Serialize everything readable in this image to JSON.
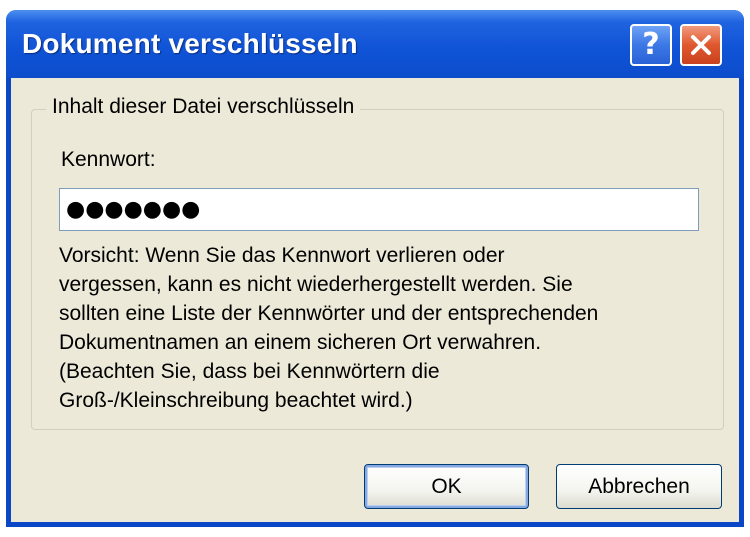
{
  "window": {
    "title": "Dokument verschlüsseln",
    "help_symbol": "?",
    "close_symbol": "✕"
  },
  "group": {
    "legend": "Inhalt dieser Datei verschlüsseln"
  },
  "password": {
    "label": "Kennwort:",
    "masked_value": "●●●●●●●"
  },
  "warning": {
    "text": "Vorsicht: Wenn Sie das Kennwort verlieren oder\nvergessen, kann es nicht wiederhergestellt werden. Sie\nsollten eine Liste der Kennwörter und der entsprechenden\nDokumentnamen an einem sicheren Ort verwahren.\n(Beachten Sie, dass bei Kennwörtern die\nGroß-/Kleinschreibung beachtet wird.)"
  },
  "buttons": {
    "ok_label": "OK",
    "cancel_label": "Abbrechen"
  },
  "colors": {
    "titlebar": "#0d4dcc",
    "dialog_body": "#ece9d8",
    "close_button": "#e0582e"
  }
}
